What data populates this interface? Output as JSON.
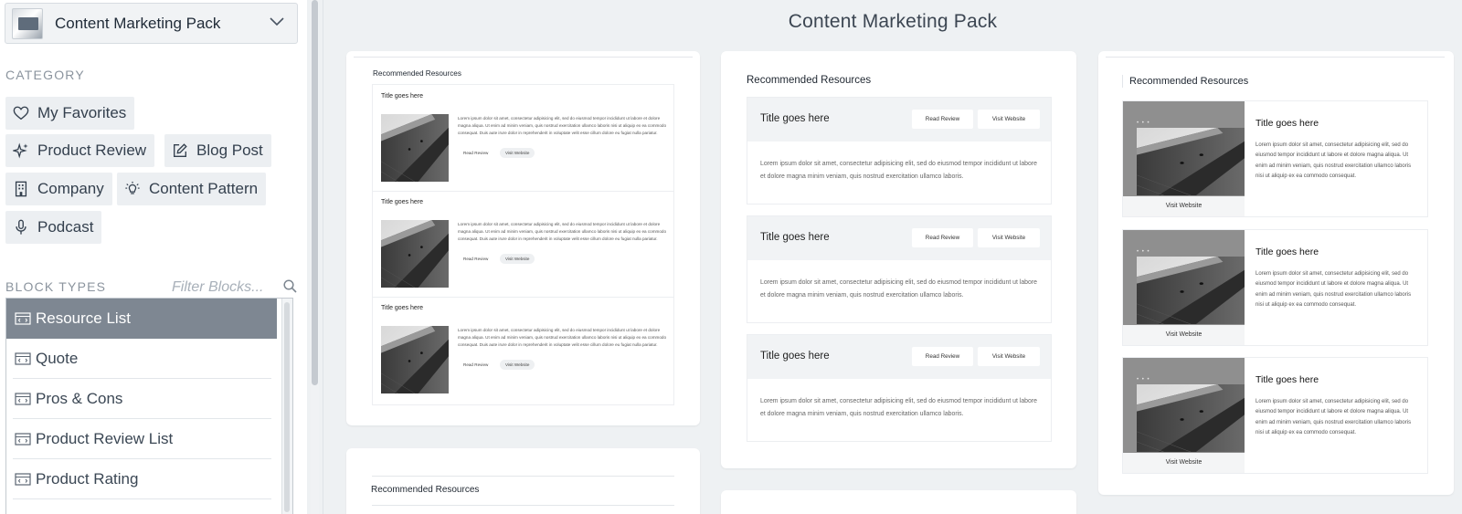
{
  "sidebar": {
    "pack_selector": {
      "name": "Content Marketing Pack",
      "thumb_icon": "pack-thumbnail",
      "chevron_icon": "chevron-down-icon"
    },
    "category_label": "CATEGORY",
    "categories": [
      {
        "label": "My Favorites",
        "icon": "heart-icon"
      },
      {
        "label": "Product Review",
        "icon": "sparkle-icon"
      },
      {
        "label": "Blog Post",
        "icon": "edit-icon"
      },
      {
        "label": "Company",
        "icon": "building-icon"
      },
      {
        "label": "Content Pattern",
        "icon": "lightbulb-icon"
      },
      {
        "label": "Podcast",
        "icon": "microphone-icon"
      }
    ],
    "block_types_label": "BLOCK TYPES",
    "filter_placeholder": "Filter Blocks...",
    "blocks": [
      {
        "label": "Resource List",
        "active": true
      },
      {
        "label": "Quote"
      },
      {
        "label": "Pros & Cons"
      },
      {
        "label": "Product Review List"
      },
      {
        "label": "Product Rating"
      }
    ]
  },
  "main": {
    "title": "Content Marketing Pack",
    "previews": {
      "heading": "Recommended Resources",
      "item_title": "Title goes here",
      "read_review": "Read Review",
      "visit_website": "Visit Website",
      "lorem_long": "Lorem ipsum dolor sit amet, consectetur adipisicing elit, sed do eiusmod tempor incididunt ut labore et dolore magna aliqua. Ut enim ad minim veniam, quis nostrud exercitation ullamco laboris nisi ut aliquip ex ea commodo consequat. Duis aute irure dolor in reprehenderit in voluptate velit esse cillum dolore eu fugiat nulla pariatur.",
      "lorem_mid": "Lorem ipsum dolor sit amet, consectetur adipisicing elit, sed do eiusmod tempor incididunt ut labore et dolore magna  minim veniam, quis nostrud exercitation ullamco laboris.",
      "lorem_short": "Lorem ipsum dolor sit amet, consectetur adipisicing elit, sed do eiusmod tempor incididunt ut labore et dolore magna aliqua. Ut enim ad minim veniam, quis nostrud exercitation ullamco laboris nisi ut aliquip ex ea commodo consequat."
    }
  }
}
